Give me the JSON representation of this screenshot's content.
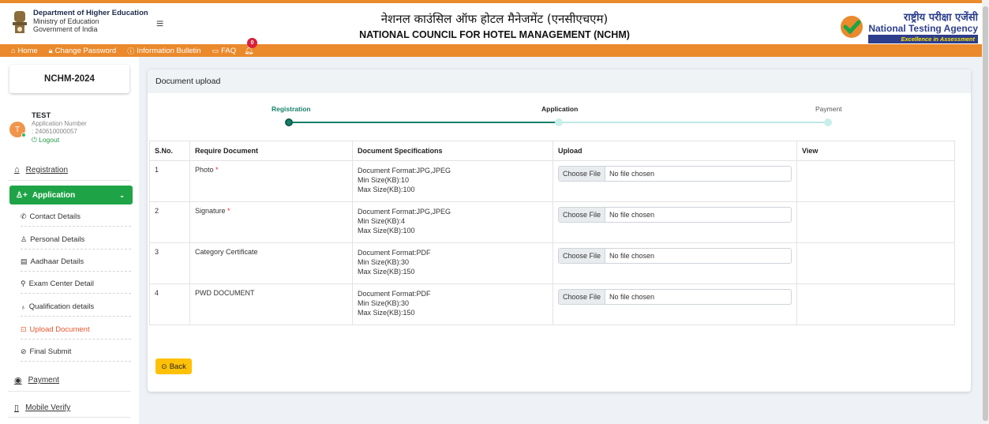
{
  "header": {
    "dept_line1": "Department of Higher Education",
    "dept_line2": "Ministry of Education",
    "dept_line3": "Government of India",
    "title_hindi": "नेशनल काउंसिल ऑफ होटल मैनेजमेंट (एनसीएचएम)",
    "title_english": "NATIONAL COUNCIL FOR HOTEL MANAGEMENT (NCHM)",
    "nta_hindi": "राष्ट्रीय परीक्षा एजेंसी",
    "nta_english": "National Testing Agency",
    "nta_tagline": "Excellence in Assessment"
  },
  "nav": {
    "home": "Home",
    "change_password": "Change Password",
    "info_bulletin": "Information Bulletin",
    "faq": "FAQ",
    "notification_count": "0"
  },
  "sidebar": {
    "brand": "NCHM-2024",
    "user_name": "TEST",
    "avatar_initial": "T",
    "app_number_label": "Application Number",
    "app_number": ": 240610000057",
    "logout": "Logout",
    "registration": "Registration",
    "application": "Application",
    "sub_items": [
      "Contact Details",
      "Personal Details",
      "Aadhaar Details",
      "Exam Center Detail",
      "Qualification details",
      "Upload Document",
      "Final Submit"
    ],
    "payment": "Payment",
    "mobile_verify": "Mobile Verify"
  },
  "main": {
    "card_title": "Document upload",
    "steps": [
      "Registration",
      "Application",
      "Payment"
    ],
    "columns": [
      "S.No.",
      "Require Document",
      "Document Specifications",
      "Upload",
      "View"
    ],
    "rows": [
      {
        "sno": "1",
        "doc": "Photo",
        "required": "*",
        "spec1": "Document Format:JPG,JPEG",
        "spec2": "Min Size(KB):10",
        "spec3": "Max Size(KB):100",
        "choose": "Choose File",
        "file": "No file chosen"
      },
      {
        "sno": "2",
        "doc": "Signature",
        "required": "*",
        "spec1": "Document Format:JPG,JPEG",
        "spec2": "Min Size(KB):4",
        "spec3": "Max Size(KB):100",
        "choose": "Choose File",
        "file": "No file chosen"
      },
      {
        "sno": "3",
        "doc": "Category Certificate",
        "required": "",
        "spec1": "Document Format:PDF",
        "spec2": "Min Size(KB):30",
        "spec3": "Max Size(KB):150",
        "choose": "Choose File",
        "file": "No file chosen"
      },
      {
        "sno": "4",
        "doc": "PWD DOCUMENT",
        "required": "",
        "spec1": "Document Format:PDF",
        "spec2": "Min Size(KB):30",
        "spec3": "Max Size(KB):150",
        "choose": "Choose File",
        "file": "No file chosen"
      }
    ],
    "back_label": "Back"
  },
  "colors": {
    "accent_orange": "#ea8a2c",
    "green": "#1ea447",
    "teal": "#17806a",
    "yellow": "#ffc107"
  }
}
